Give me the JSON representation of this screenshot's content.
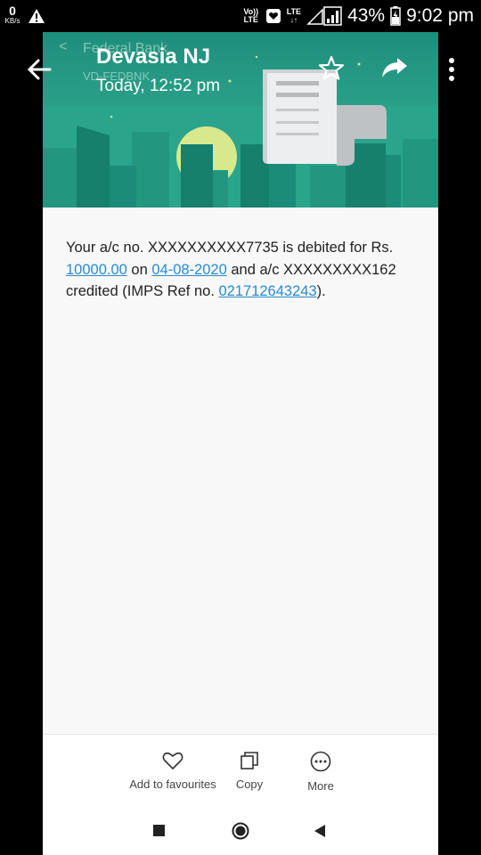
{
  "status_bar": {
    "kbs_value": "0",
    "kbs_unit": "KB/s",
    "volte": "Vo)) LTE",
    "lte": "LTE",
    "battery_pct": "43%",
    "time": "9:02 pm"
  },
  "header": {
    "bank_name": "Federal Bank",
    "sender_id": "VD-FEDBNK",
    "title": "Devasia NJ",
    "subtitle": "Today, 12:52 pm"
  },
  "message": {
    "part1": "Your a/c no. XXXXXXXXXX7735 is debited for Rs. ",
    "amount": "10000.00",
    "part2": " on ",
    "date": "04-08-2020",
    "part3": " and a/c XXXXXXXXX162 credited (IMPS Ref no. ",
    "ref": "021712643243",
    "part4": ")."
  },
  "actions": {
    "favourite": "Add to favourites",
    "copy": "Copy",
    "more": "More"
  },
  "colors": {
    "header_bg": "#1f9e87",
    "link": "#2a8ad0"
  }
}
